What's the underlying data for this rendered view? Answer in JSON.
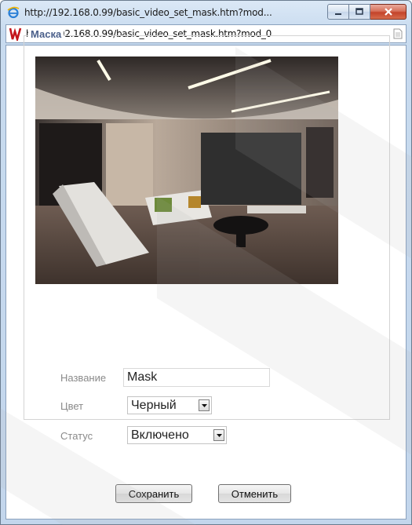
{
  "window": {
    "title": "http://192.168.0.99/basic_video_set_mask.htm?mod...",
    "address": "http://192.168.0.99/basic_video_set_mask.htm?mod_0"
  },
  "mask_panel": {
    "legend": "Маска",
    "name_label": "Название",
    "name_value": "Mask",
    "color_label": "Цвет",
    "color_value": "Черный",
    "status_label": "Статус",
    "status_value": "Включено"
  },
  "buttons": {
    "save": "Сохранить",
    "cancel": "Отменить"
  },
  "colors": {
    "legend_text": "#4a5f8a",
    "mask_fill": "#2f2f2f",
    "label_text": "#8a8a8a"
  }
}
